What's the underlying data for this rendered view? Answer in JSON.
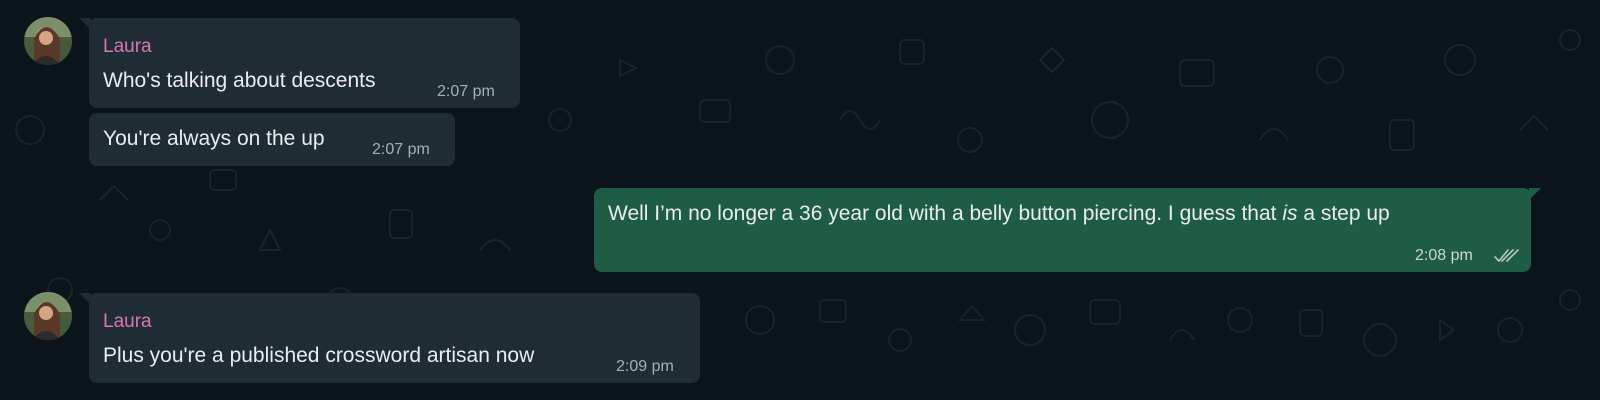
{
  "colors": {
    "background": "#0b141a",
    "incoming_bubble": "#202c33",
    "outgoing_bubble": "#1f5c45",
    "sender_name": "#d976b4",
    "message_text": "#e9edef",
    "timestamp": "#a5b0b6"
  },
  "messages": [
    {
      "sender": "Laura",
      "text": "Who's talking about descents",
      "time": "2:07 pm",
      "direction": "incoming",
      "avatar": "laura-avatar"
    },
    {
      "text": "You're always on the up",
      "time": "2:07 pm",
      "direction": "incoming"
    },
    {
      "text_before": "Well I’m no longer a 36 year old with a belly button piercing. I guess that ",
      "text_italic": "is",
      "text_after": " a step up",
      "time": "2:08 pm",
      "direction": "outgoing",
      "status_icon": "double-check-icon"
    },
    {
      "sender": "Laura",
      "text": "Plus you're a published crossword artisan now",
      "time": "2:09 pm",
      "direction": "incoming",
      "avatar": "laura-avatar"
    }
  ]
}
